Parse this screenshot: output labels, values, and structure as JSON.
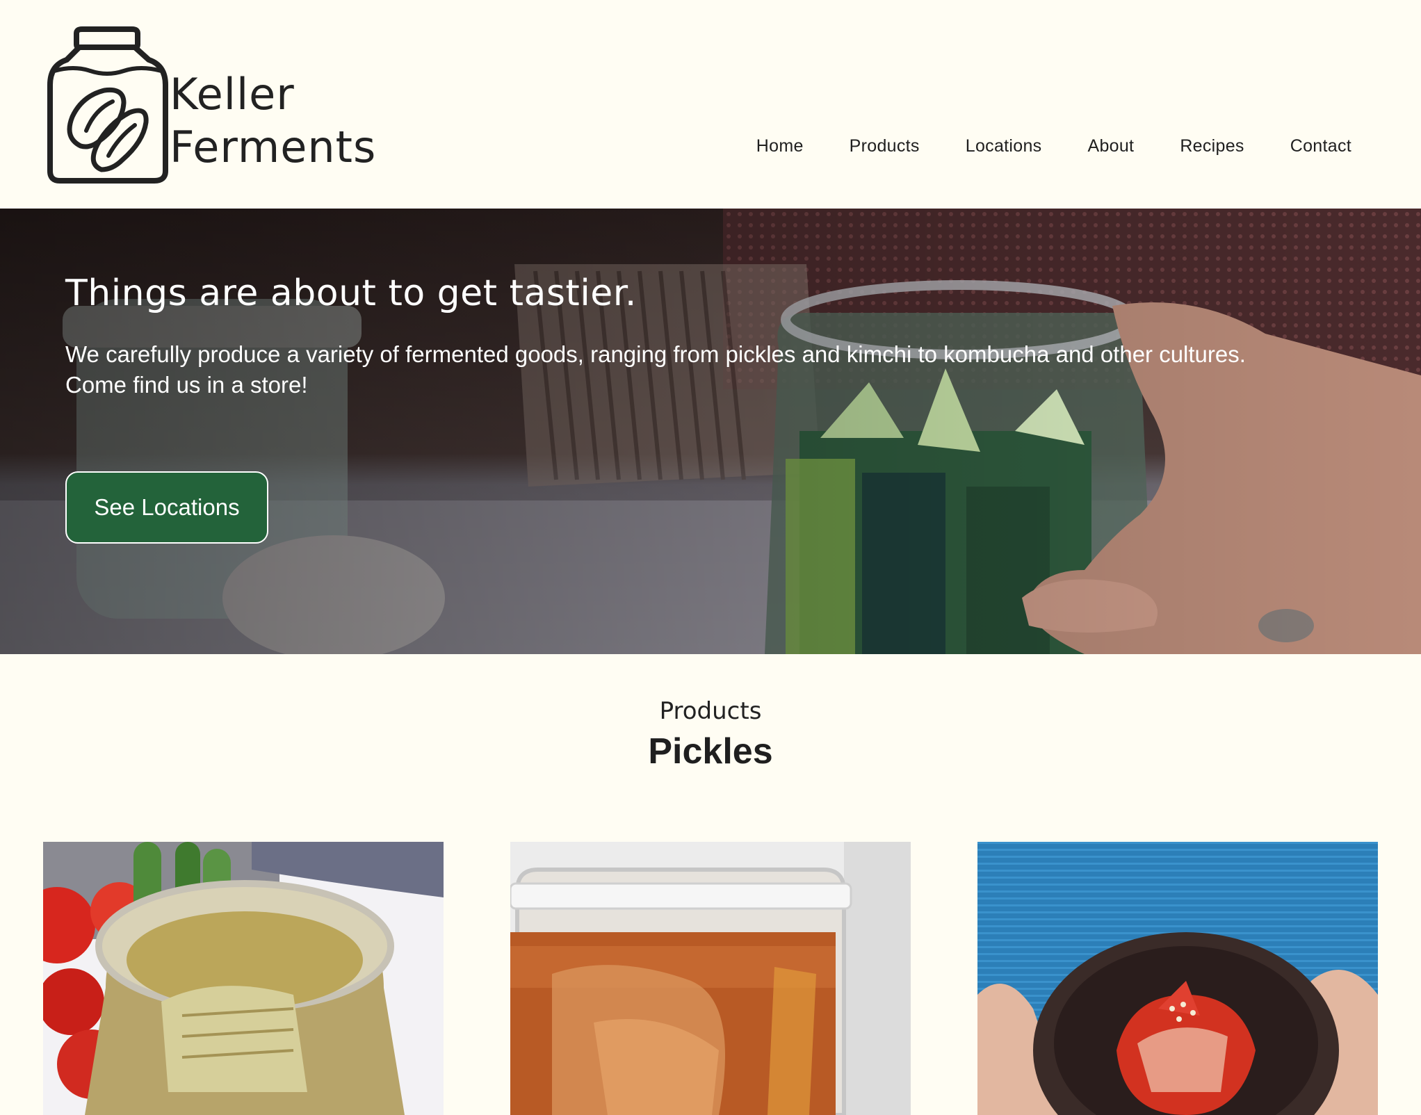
{
  "brand": {
    "name_line1": "Keller",
    "name_line2": "Ferments",
    "logo_icon": "pickle-jar-icon"
  },
  "nav": {
    "items": [
      "Home",
      "Products",
      "Locations",
      "About",
      "Recipes",
      "Contact"
    ]
  },
  "hero": {
    "title": "Things are about to get tastier.",
    "body": "We carefully produce a variety of fermented goods, ranging from pickles and kimchi to kombucha and other cultures. Come find us in a store!",
    "button_label": "See Locations",
    "button_color": "#23633a"
  },
  "products": {
    "eyebrow": "Products",
    "title": "Pickles",
    "cards": [
      {
        "image": "pickle-jar-photo"
      },
      {
        "image": "kombucha-jar-photo"
      },
      {
        "image": "kimchi-bowl-photo"
      }
    ]
  },
  "colors": {
    "background": "#fffdf3",
    "accent": "#23633a",
    "text": "#1f1f1f"
  }
}
